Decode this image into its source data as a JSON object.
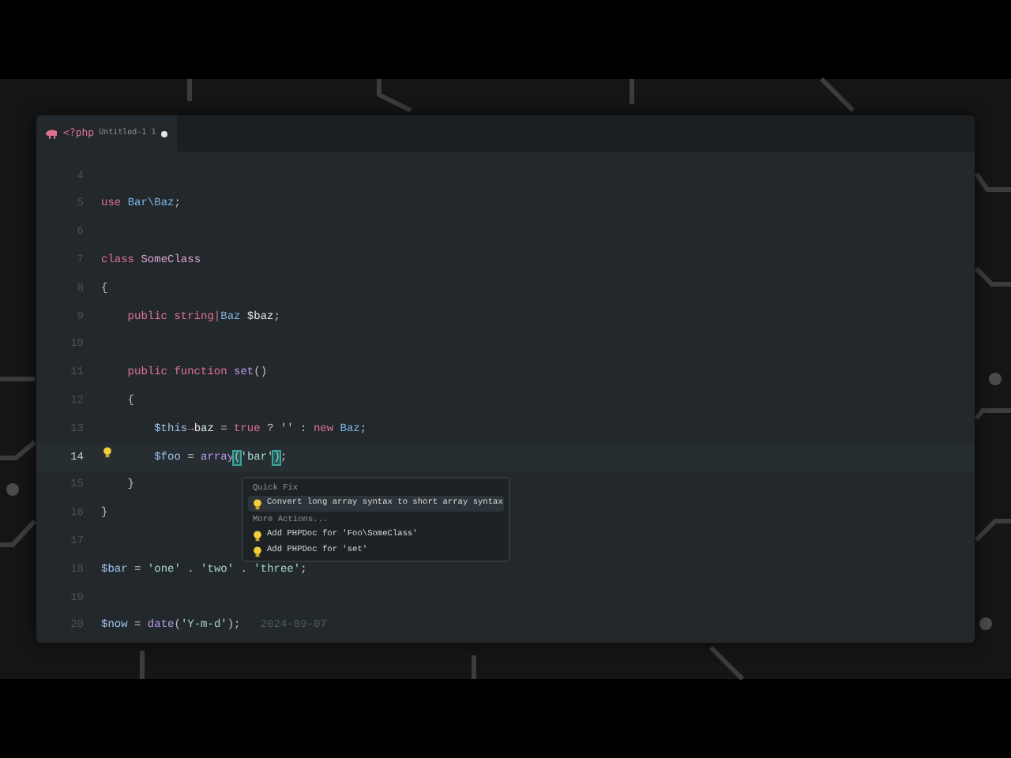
{
  "tab": {
    "language": "<?php",
    "filename": "Untitled-1",
    "problems": "1",
    "modified": true
  },
  "lines": [
    {
      "number": "4",
      "current": false
    },
    {
      "number": "5",
      "current": false,
      "tokens": [
        {
          "kind": "keyword",
          "text": "use "
        },
        {
          "kind": "class",
          "text": "Bar\\Baz"
        },
        {
          "kind": "punct",
          "text": ";"
        }
      ]
    },
    {
      "number": "6",
      "current": false
    },
    {
      "number": "7",
      "current": false,
      "tokens": [
        {
          "kind": "keyword",
          "text": "class "
        },
        {
          "kind": "type",
          "text": "SomeClass"
        }
      ]
    },
    {
      "number": "8",
      "current": false,
      "tokens": [
        {
          "kind": "punct",
          "text": "{"
        }
      ]
    },
    {
      "number": "9",
      "current": false,
      "tokens": [
        {
          "kind": "keyword",
          "text": "    public string"
        },
        {
          "kind": "operator",
          "text": "|"
        },
        {
          "kind": "class",
          "text": "Baz"
        },
        {
          "kind": "plain",
          "text": " $baz"
        },
        {
          "kind": "punct",
          "text": ";"
        }
      ]
    },
    {
      "number": "10",
      "current": false
    },
    {
      "number": "11",
      "current": false,
      "tokens": [
        {
          "kind": "keyword",
          "text": "    public function "
        },
        {
          "kind": "function",
          "text": "set"
        },
        {
          "kind": "punct",
          "text": "()"
        }
      ]
    },
    {
      "number": "12",
      "current": false,
      "tokens": [
        {
          "kind": "punct",
          "text": "    {"
        }
      ]
    },
    {
      "number": "13",
      "current": false,
      "tokens": [
        {
          "kind": "variable",
          "text": "        $this"
        },
        {
          "kind": "operator",
          "text": "→"
        },
        {
          "kind": "plain",
          "text": "baz"
        },
        {
          "kind": "punct",
          "text": " = "
        },
        {
          "kind": "keyword",
          "text": "true"
        },
        {
          "kind": "punct",
          "text": " ? "
        },
        {
          "kind": "string",
          "text": "''"
        },
        {
          "kind": "punct",
          "text": " : "
        },
        {
          "kind": "keyword",
          "text": "new "
        },
        {
          "kind": "class",
          "text": "Baz"
        },
        {
          "kind": "punct",
          "text": ";"
        }
      ]
    },
    {
      "number": "14",
      "current": true,
      "lightbulb": true,
      "tokens": [
        {
          "kind": "variable",
          "text": "        $foo"
        },
        {
          "kind": "punct",
          "text": " = "
        },
        {
          "kind": "function",
          "text": "array"
        },
        {
          "kind": "bracket-match",
          "text": "("
        },
        {
          "kind": "string",
          "text": "'bar'"
        },
        {
          "kind": "bracket-match",
          "text": ")"
        },
        {
          "kind": "punct",
          "text": ";"
        }
      ]
    },
    {
      "number": "15",
      "current": false,
      "tokens": [
        {
          "kind": "punct",
          "text": "    }"
        }
      ]
    },
    {
      "number": "16",
      "current": false,
      "tokens": [
        {
          "kind": "punct",
          "text": "}"
        }
      ]
    },
    {
      "number": "17",
      "current": false
    },
    {
      "number": "18",
      "current": false,
      "tokens": [
        {
          "kind": "variable",
          "text": "$bar"
        },
        {
          "kind": "punct",
          "text": " = "
        },
        {
          "kind": "string",
          "text": "'one'"
        },
        {
          "kind": "punct",
          "text": " . "
        },
        {
          "kind": "string",
          "text": "'two'"
        },
        {
          "kind": "punct",
          "text": " . "
        },
        {
          "kind": "string",
          "text": "'three'"
        },
        {
          "kind": "punct",
          "text": ";"
        }
      ]
    },
    {
      "number": "19",
      "current": false
    },
    {
      "number": "20",
      "current": false,
      "tokens": [
        {
          "kind": "variable",
          "text": "$now"
        },
        {
          "kind": "punct",
          "text": " = "
        },
        {
          "kind": "function",
          "text": "date"
        },
        {
          "kind": "punct",
          "text": "("
        },
        {
          "kind": "string",
          "text": "'Y-m-d'"
        },
        {
          "kind": "punct",
          "text": ");"
        },
        {
          "kind": "hint",
          "text": "   2024-09-07"
        }
      ]
    }
  ],
  "quick_fix_menu": {
    "sections": [
      {
        "header": "Quick Fix",
        "items": [
          {
            "label": "Convert long array syntax to short array syntax",
            "selected": true
          }
        ]
      },
      {
        "header": "More Actions...",
        "items": [
          {
            "label": "Add PHPDoc for 'Foo\\SomeClass'",
            "selected": false
          },
          {
            "label": "Add PHPDoc for 'set'",
            "selected": false
          }
        ]
      }
    ]
  }
}
